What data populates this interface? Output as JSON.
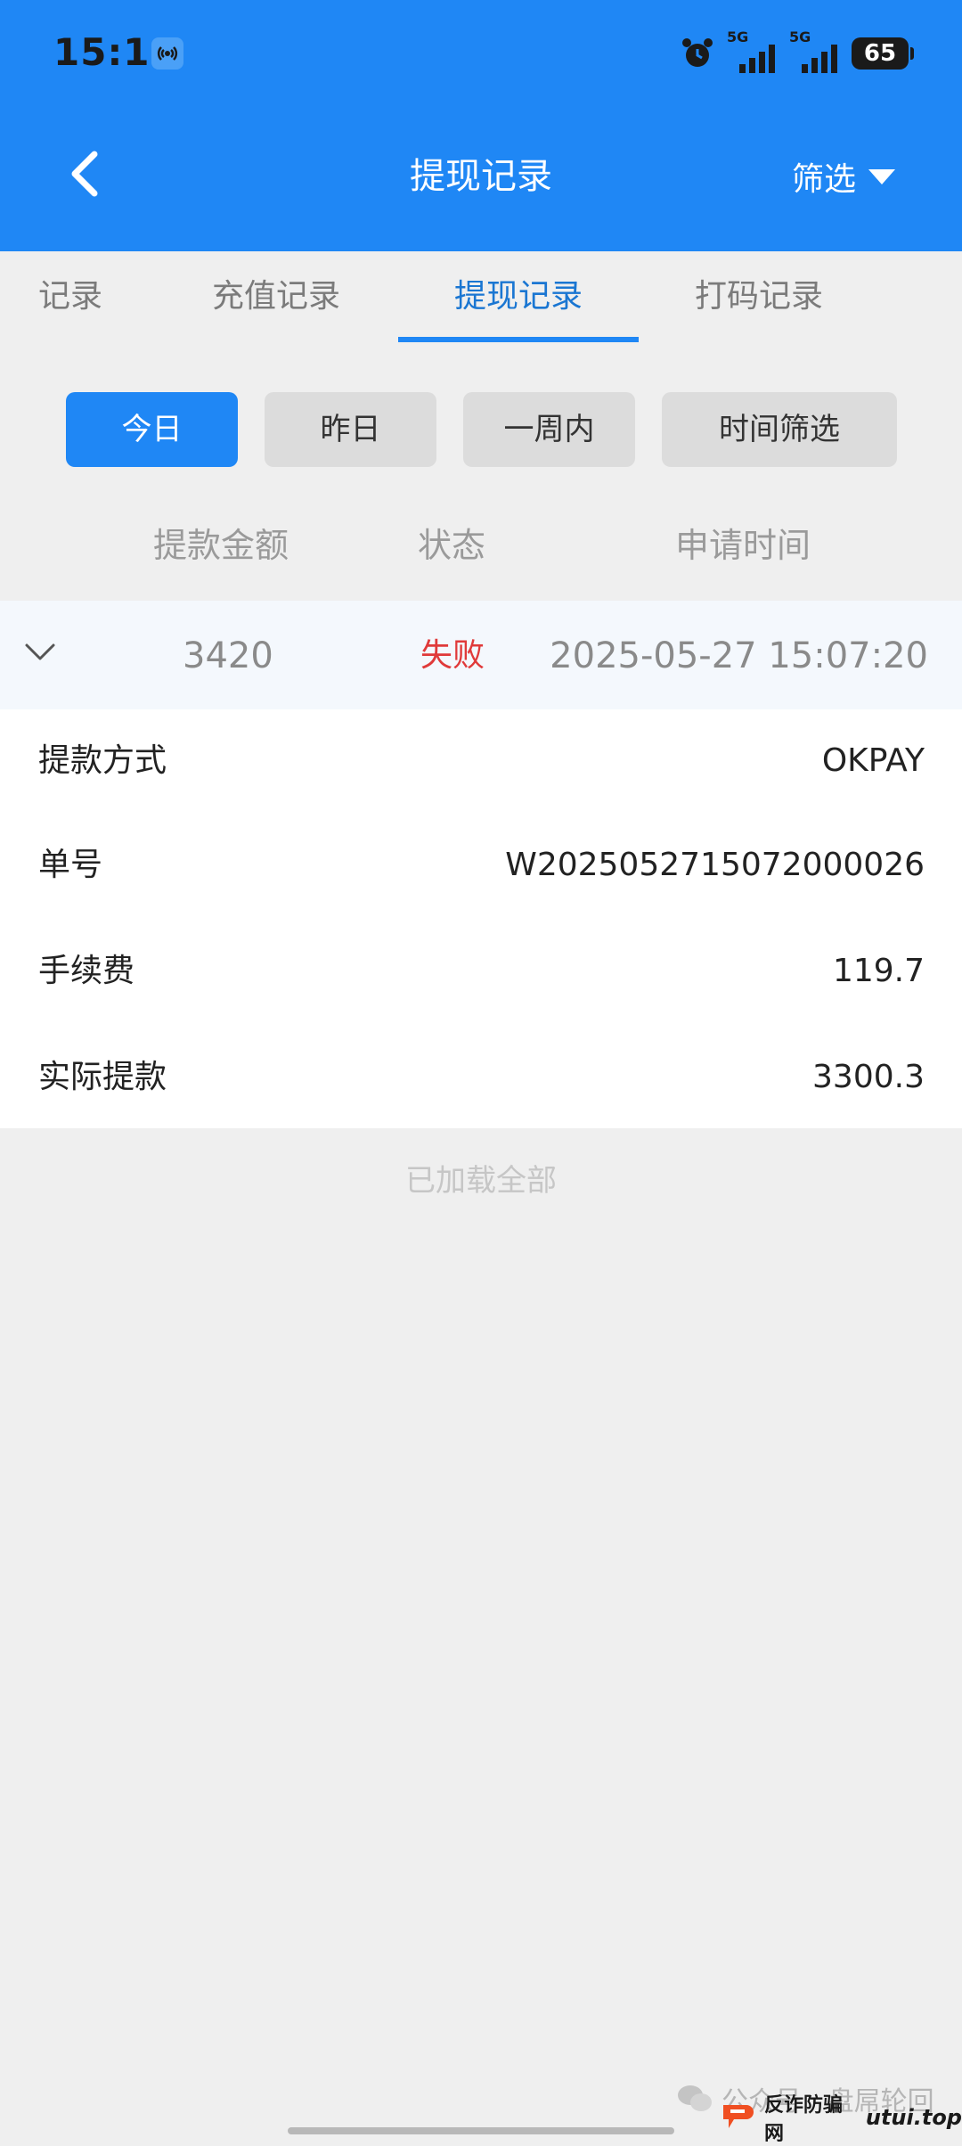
{
  "status_bar": {
    "time": "15:11",
    "network1": "5G",
    "network2": "5G",
    "battery": "65"
  },
  "header": {
    "title": "提现记录",
    "filter_label": "筛选"
  },
  "tabs": [
    {
      "label": "记录"
    },
    {
      "label": "充值记录"
    },
    {
      "label": "提现记录",
      "active": true
    },
    {
      "label": "打码记录"
    }
  ],
  "date_filters": [
    {
      "label": "今日",
      "active": true
    },
    {
      "label": "昨日"
    },
    {
      "label": "一周内"
    },
    {
      "label": "时间筛选"
    }
  ],
  "columns": {
    "amount": "提款金额",
    "status": "状态",
    "time": "申请时间"
  },
  "record": {
    "amount": "3420",
    "status": "失败",
    "time": "2025-05-27 15:07:20",
    "details": [
      {
        "label": "提款方式",
        "value": "OKPAY"
      },
      {
        "label": "单号",
        "value": "W2025052715072000026"
      },
      {
        "label": "手续费",
        "value": "119.7"
      },
      {
        "label": "实际提款",
        "value": "3300.3"
      }
    ]
  },
  "footer": {
    "loaded_all": "已加载全部"
  },
  "watermark": {
    "text": "公众号 · 盘屌轮回",
    "badge_text": "反诈防骗网",
    "badge_domain": "utui.top"
  },
  "colors": {
    "header_blue": "#1f87f5",
    "active_tab": "#1a76d2",
    "status_failed": "#e03a3a"
  }
}
